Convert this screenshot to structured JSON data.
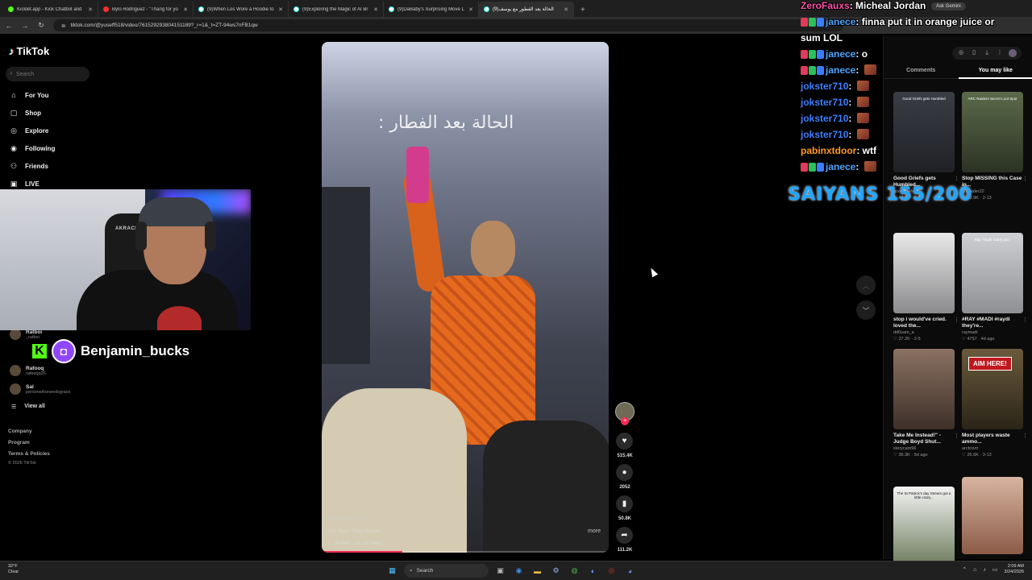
{
  "browser": {
    "tabs": [
      {
        "label": "Kicklet.app - Kick Chatbot and",
        "icon": "kick-favicon"
      },
      {
        "label": "Bylo Rodriguez - \"Thang for yo",
        "icon": "youtube-favicon"
      },
      {
        "label": "(9)When Los Wore a Hoodie to",
        "icon": "tiktok-favicon"
      },
      {
        "label": "(9)Exploring the Magic of AI Br",
        "icon": "tiktok-favicon"
      },
      {
        "label": "(9)DaBaby's Surprising Move L",
        "icon": "tiktok-favicon"
      },
      {
        "label": "(9)الحالة بعد الفطور مع يوسف",
        "icon": "tiktok-favicon"
      }
    ],
    "url": "tiktok.com/@yuseff518/video/761529293804151189?_r=1&_t=ZT-94ws7nFB1qw",
    "gemini_label": "Ask Gemini"
  },
  "sidebar": {
    "logo": "TikTok",
    "search_placeholder": "Search",
    "nav": [
      {
        "label": "For You",
        "icon": "home-icon"
      },
      {
        "label": "Shop",
        "icon": "shop-icon"
      },
      {
        "label": "Explore",
        "icon": "compass-icon"
      },
      {
        "label": "Following",
        "icon": "following-icon"
      },
      {
        "label": "Friends",
        "icon": "friends-icon"
      },
      {
        "label": "LIVE",
        "icon": "live-icon"
      }
    ],
    "following": [
      {
        "name": "Ratboi",
        "handle": "_ratboi"
      },
      {
        "name": "Rafooq",
        "handle": "rafeeqa26"
      },
      {
        "name": "Sal",
        "handle": "personwhoneedsgrass"
      }
    ],
    "view_all": "View all",
    "footer": [
      "Company",
      "Program",
      "Terms & Policies"
    ],
    "copyright": "© 2026 TikTok"
  },
  "webcam": {
    "chair_brand": "AKRACING"
  },
  "overlay": {
    "streamer_name": "Benjamin_bucks",
    "goal_text": "SAIYANS 155/200"
  },
  "video": {
    "caption_overlay": "الحالة بعد الفطار :",
    "author": "yuseff518 · 3-9",
    "hashtags": "#4u #fyp · #fyp #foryou",
    "more_label": "more",
    "music": "20 Min - Lil Uzi Vert",
    "progress": 0.28,
    "likes": "515.4K",
    "comments": "2052",
    "saves": "50.8K",
    "shares": "111.2K"
  },
  "chat": [
    {
      "user": "ZeroFauxs",
      "color": "#ff4fa8",
      "message": "Micheal Jordan",
      "badges": false,
      "emote": false
    },
    {
      "user": "janece",
      "color": "#4aa3ff",
      "message": "finna put it in orange juice or",
      "badges": true,
      "emote": false
    },
    {
      "user": "",
      "color": "#ffffff",
      "message": "sum LOL",
      "badges": false,
      "emote": false
    },
    {
      "user": "janece",
      "color": "#4aa3ff",
      "message": "o",
      "badges": true,
      "emote": false
    },
    {
      "user": "janece",
      "color": "#4aa3ff",
      "message": "",
      "badges": true,
      "emote": true
    },
    {
      "user": "jokster710",
      "color": "#3f7dff",
      "message": "",
      "badges": false,
      "emote": true
    },
    {
      "user": "jokster710",
      "color": "#3f7dff",
      "message": "",
      "badges": false,
      "emote": true
    },
    {
      "user": "jokster710",
      "color": "#3f7dff",
      "message": "",
      "badges": false,
      "emote": true
    },
    {
      "user": "jokster710",
      "color": "#3f7dff",
      "message": "",
      "badges": false,
      "emote": true
    },
    {
      "user": "pabinxtdoor",
      "color": "#ff9a1f",
      "message": "wtf",
      "badges": false,
      "emote": false
    },
    {
      "user": "janece",
      "color": "#4aa3ff",
      "message": "",
      "badges": true,
      "emote": true
    }
  ],
  "right_panel": {
    "tabs": [
      "Comments",
      "You may like"
    ],
    "active_tab": "You may like",
    "cards": [
      {
        "title": "Good Griefs gets Humbled...",
        "handle": "goodgriefs",
        "likes": "43.1K",
        "date": "2-12",
        "thumb_text": "Good Griefs gets Humbled",
        "colors": [
          "#3a3d44",
          "#1f2126"
        ]
      },
      {
        "title": "Stop MISSING this Case in...",
        "handle": "arcraider22",
        "likes": "28.9K",
        "date": "2-13",
        "thumb_text": "ARC Raiders Secret Loot Spot",
        "colors": [
          "#5b6a4a",
          "#2b3324"
        ]
      },
      {
        "title": "stop i would've cried. loved the...",
        "handle": "dd0sam_a",
        "likes": "27.2K",
        "date": "2-5",
        "thumb_text": "",
        "colors": [
          "#e9e9ea",
          "#8a8a8c"
        ]
      },
      {
        "title": "#RAY #MADI #raydi they're...",
        "handle": "raymadi",
        "likes": "4757",
        "date": "4d ago",
        "thumb_text": "Ray \"might marry you\"",
        "colors": [
          "#cfd0d4",
          "#8e8f93"
        ]
      },
      {
        "title": "Take Me Instead!\" - Judge Boyd Shut...",
        "handle": "storycam96",
        "likes": "36.3K",
        "date": "5d ago",
        "thumb_text": "",
        "colors": [
          "#8a7162",
          "#3d3029"
        ]
      },
      {
        "title": "Most players waste ammo...",
        "handle": "arctrovrt",
        "likes": "26.6K",
        "date": "3-13",
        "thumb_text": "AIM HERE!",
        "colors": [
          "#6b5a3c",
          "#2a2418"
        ]
      },
      {
        "title": "",
        "handle": "",
        "likes": "",
        "date": "",
        "thumb_text": "The St Patrick's day Stream got a little crazy...",
        "colors": [
          "#f4f4f4",
          "#6b7a5a"
        ]
      },
      {
        "title": "",
        "handle": "",
        "likes": "",
        "date": "",
        "thumb_text": "",
        "colors": [
          "#d7b4a0",
          "#8b5c48"
        ]
      }
    ]
  },
  "taskbar": {
    "weather_temp": "32°F",
    "weather_desc": "Clear",
    "search_label": "Search",
    "time": "2:09 AM",
    "date": "3/24/2026"
  }
}
